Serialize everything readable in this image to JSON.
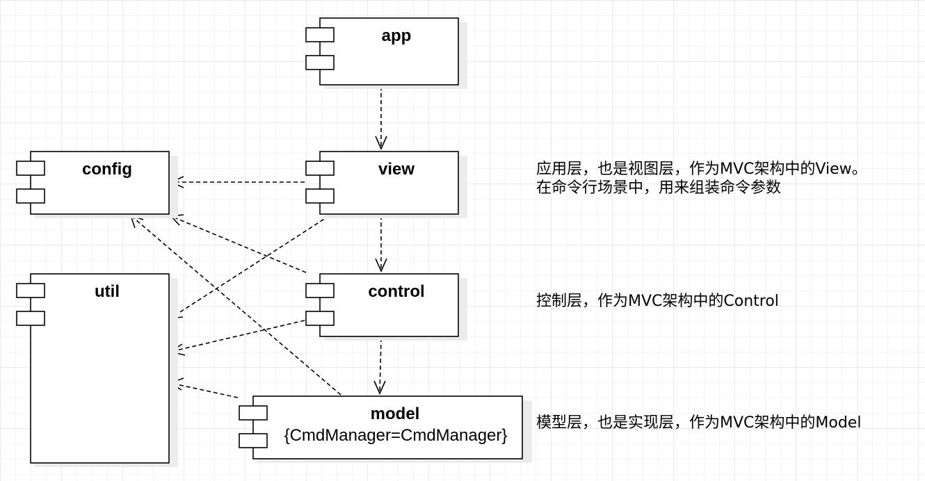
{
  "components": {
    "app": {
      "title": "app"
    },
    "view": {
      "title": "view"
    },
    "config": {
      "title": "config"
    },
    "util": {
      "title": "util"
    },
    "control": {
      "title": "control"
    },
    "model": {
      "title": "model",
      "property": "{CmdManager=CmdManager}"
    }
  },
  "notes": {
    "view_line1": "应用层，也是视图层，作为MVC架构中的View。",
    "view_line2": "在命令行场景中，用来组装命令参数",
    "control": "控制层，作为MVC架构中的Control",
    "model": "模型层，也是实现层，作为MVC架构中的Model"
  },
  "dependencies": [
    {
      "from": "app",
      "to": "view"
    },
    {
      "from": "view",
      "to": "config"
    },
    {
      "from": "view",
      "to": "util"
    },
    {
      "from": "view",
      "to": "control"
    },
    {
      "from": "control",
      "to": "config"
    },
    {
      "from": "control",
      "to": "util"
    },
    {
      "from": "control",
      "to": "model"
    },
    {
      "from": "model",
      "to": "util"
    },
    {
      "from": "model",
      "to": "config"
    }
  ],
  "colors": {
    "stroke": "#000000",
    "fill": "#ffffff",
    "shadow": "#ececec",
    "grid_minor": "#e9e9e9",
    "grid_major": "#d6d6d6"
  }
}
